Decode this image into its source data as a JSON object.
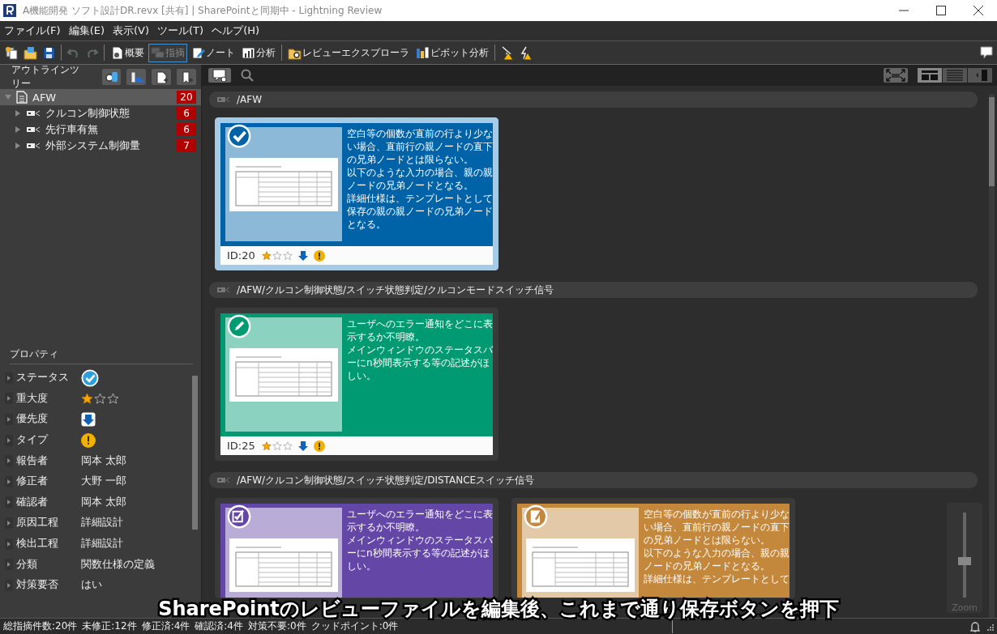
{
  "window": {
    "title": "A機能開発 ソフト設計DR.revx [共有] | SharePointと同期中 - Lightning Review"
  },
  "menu": [
    "ファイル(F)",
    "編集(E)",
    "表示(V)",
    "ツール(T)",
    "ヘルプ(H)"
  ],
  "toolbar": [
    [
      {
        "kind": "copy"
      },
      {
        "kind": "open"
      },
      {
        "kind": "save"
      }
    ],
    [
      {
        "kind": "undo",
        "disabled": true
      },
      {
        "kind": "redo",
        "disabled": true
      }
    ],
    [
      {
        "kind": "overview",
        "label": "概要",
        "selected": false
      },
      {
        "kind": "comment",
        "label": "指摘",
        "selected": true
      },
      {
        "kind": "note",
        "label": "ノート",
        "selected": false
      },
      {
        "kind": "chart",
        "label": "分析",
        "selected": false
      }
    ],
    [
      {
        "kind": "explorer",
        "label": "レビューエクスプローラ"
      },
      {
        "kind": "pivot",
        "label": "ピボット分析"
      }
    ],
    [
      {
        "kind": "warning"
      },
      {
        "kind": "warning2"
      }
    ]
  ],
  "outline": {
    "title": "アウトラインツリー",
    "tree": [
      {
        "label": "AFW",
        "count": "20",
        "expanded": true,
        "selected": true,
        "children": [
          {
            "label": "クルコン制御状態",
            "count": "6",
            "expanded": false,
            "selected": false
          },
          {
            "label": "先行車有無",
            "count": "6",
            "expanded": false,
            "selected": false
          },
          {
            "label": "外部システム制御量",
            "count": "7",
            "expanded": false,
            "selected": false
          }
        ]
      }
    ]
  },
  "properties": {
    "title": "プロパティ",
    "rows": [
      {
        "label": "ステータス",
        "kind": "check"
      },
      {
        "label": "重大度",
        "kind": "stars",
        "stars": 1
      },
      {
        "label": "優先度",
        "kind": "arrow"
      },
      {
        "label": "タイプ",
        "kind": "alert"
      },
      {
        "label": "報告者",
        "kind": "text",
        "value": "岡本 太郎"
      },
      {
        "label": "修正者",
        "kind": "text",
        "value": "大野 一郎"
      },
      {
        "label": "確認者",
        "kind": "text",
        "value": "岡本 太郎"
      },
      {
        "label": "原因工程",
        "kind": "text",
        "value": "詳細設計"
      },
      {
        "label": "検出工程",
        "kind": "text",
        "value": "詳細設計"
      },
      {
        "label": "分類",
        "kind": "text",
        "value": "関数仕様の定義"
      },
      {
        "label": "対策要否",
        "kind": "text",
        "value": "はい"
      }
    ]
  },
  "views": [
    {
      "kind": "cards",
      "selected": true
    },
    {
      "kind": "list",
      "selected": false
    },
    {
      "kind": "side",
      "selected": false
    }
  ],
  "groups": [
    {
      "path": "/AFW",
      "cards": [
        {
          "kind": "done",
          "color": "#0063a8",
          "selected": true,
          "paragraphs": [
            "空白等の個数が直前の行より少ない場合、直前行の親ノードの直下の兄弟ノードとは限らない。",
            "以下のような入力の場合、親の親ノードの兄弟ノードとなる。",
            "詳細仕様は、テンプレートとして保存の親の親ノードの兄弟ノードとなる。"
          ],
          "id": "ID:20",
          "stars": 1,
          "marks": [
            {
              "kind": "arrow"
            },
            {
              "kind": "alert"
            }
          ]
        }
      ]
    },
    {
      "path": "/AFW/クルコン制御状態/スイッチ状態判定/クルコンモードスイッチ信号",
      "cards": [
        {
          "kind": "fixing",
          "color": "#009a72",
          "selected": false,
          "paragraphs": [
            "ユーザへのエラー通知をどこに表示するか不明瞭。",
            "メインウィンドウのステータスバーにn秒間表示する等の記述がほしい。"
          ],
          "id": "ID:25",
          "stars": 1,
          "marks": [
            {
              "kind": "arrow"
            },
            {
              "kind": "alert"
            }
          ]
        }
      ]
    },
    {
      "path": "/AFW/クルコン制御状態/スイッチ状態判定/DISTANCEスイッチ信号",
      "cards": [
        {
          "kind": "confirmed",
          "color": "#6446a6",
          "selected": false,
          "paragraphs": [
            "ユーザへのエラー通知をどこに表示するか不明瞭。",
            "メインウィンドウのステータスバーにn秒間表示する等の記述がほしい。"
          ]
        },
        {
          "kind": "open",
          "color": "#c4883d",
          "selected": false,
          "paragraphs": [
            "空白等の個数が直前の行より少ない場合、直前行の親ノードの直下の兄弟ノードとは限らない。",
            "以下のような入力の場合、親の親ノードの兄弟ノードとなる。",
            "詳細仕様は、テンプレートとして"
          ]
        }
      ]
    }
  ],
  "zoom": {
    "label": "Zoom",
    "level": 0.43
  },
  "caption": "SharePointのレビューファイルを編集後、これまで通り保存ボタンを押下",
  "status_bar": [
    "総指摘件数:20件",
    "未修正:12件",
    "修正済:4件",
    "確認済:4件",
    "対策不要:0件",
    "クッドポイント:0件"
  ]
}
